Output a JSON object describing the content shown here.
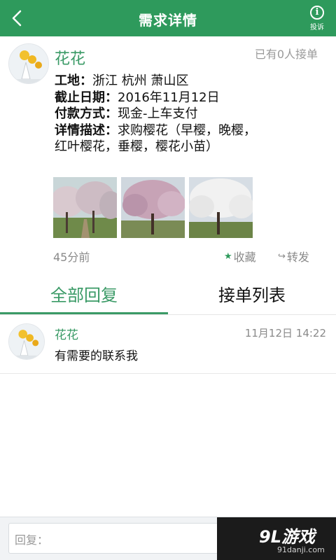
{
  "header": {
    "title": "需求详情",
    "report_label": "投诉",
    "report_glyph": "i"
  },
  "post": {
    "user_name": "花花",
    "taker_count": "已有0人接单",
    "lines": [
      {
        "label": "工地：",
        "value": "浙江 杭州 萧山区"
      },
      {
        "label": "截止日期：",
        "value": "2016年11月12日"
      },
      {
        "label": "付款方式：",
        "value": "现金-上车支付"
      },
      {
        "label": "详情描述：",
        "value": "求购樱花（早樱，晚樱，红叶樱花，垂樱，樱花小苗）"
      }
    ],
    "time_ago": "45分前",
    "favorite_label": "收藏",
    "share_label": "转发"
  },
  "tabs": [
    {
      "label": "全部回复",
      "active": true
    },
    {
      "label": "接单列表",
      "active": false
    }
  ],
  "replies": [
    {
      "user_name": "花花",
      "time": "11月12日 14:22",
      "text": "有需要的联系我"
    }
  ],
  "bottom": {
    "placeholder": "回复：",
    "watermark_main": "9L游戏",
    "watermark_sub": "91danji.com"
  },
  "colors": {
    "brand": "#2e9a5c",
    "accent_text": "#3a9a66"
  }
}
